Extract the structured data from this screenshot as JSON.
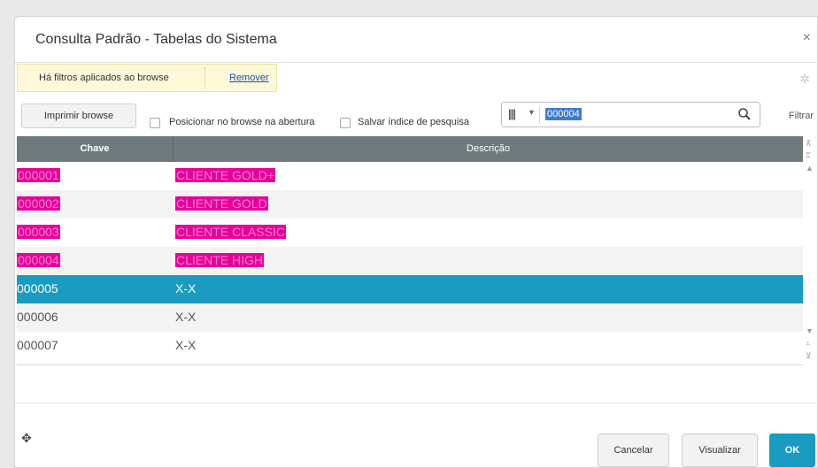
{
  "window": {
    "title": "Consulta Padrão - Tabelas do Sistema",
    "close": "×"
  },
  "filter_bar": {
    "text": "Há filtros aplicados ao browse",
    "remove": "Remover"
  },
  "toolbar": {
    "print_label": "Imprimir browse",
    "opt_position": "Posicionar no browse na abertura",
    "opt_save_index": "Salvar índice de pesquisa",
    "search_value": "000004",
    "filter_label": "Filtrar"
  },
  "grid": {
    "columns": [
      "Chave",
      "Descrição"
    ],
    "rows": [
      {
        "key": "000001",
        "desc": "CLIENTE GOLD+"
      },
      {
        "key": "000002",
        "desc": "CLIENTE GOLD "
      },
      {
        "key": "000003",
        "desc": "CLIENTE CLASSIC"
      },
      {
        "key": "000004",
        "desc": "CLIENTE HIGH"
      },
      {
        "key": "000005",
        "desc": "X-X"
      },
      {
        "key": "000006",
        "desc": "X-X"
      },
      {
        "key": "000007",
        "desc": "X-X"
      }
    ]
  },
  "footer": {
    "cancel": "Cancelar",
    "view": "Visualizar",
    "ok": "OK"
  },
  "colors": {
    "accent": "#1a9bc1",
    "highlight": "#e8009b",
    "header": "#6f7a7d",
    "filter_bg": "#fdf9d8"
  },
  "icons": [
    "close-icon",
    "gear-icon",
    "index-icon",
    "search-icon",
    "scroll-arrow-icons",
    "move-icon"
  ]
}
